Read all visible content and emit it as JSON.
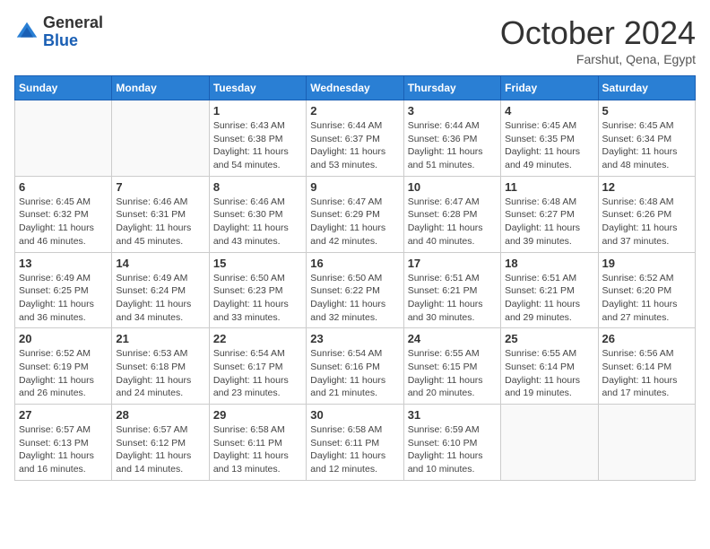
{
  "header": {
    "logo_line1": "General",
    "logo_line2": "Blue",
    "month": "October 2024",
    "location": "Farshut, Qena, Egypt"
  },
  "days_of_week": [
    "Sunday",
    "Monday",
    "Tuesday",
    "Wednesday",
    "Thursday",
    "Friday",
    "Saturday"
  ],
  "weeks": [
    [
      {
        "day": "",
        "info": ""
      },
      {
        "day": "",
        "info": ""
      },
      {
        "day": "1",
        "info": "Sunrise: 6:43 AM\nSunset: 6:38 PM\nDaylight: 11 hours and 54 minutes."
      },
      {
        "day": "2",
        "info": "Sunrise: 6:44 AM\nSunset: 6:37 PM\nDaylight: 11 hours and 53 minutes."
      },
      {
        "day": "3",
        "info": "Sunrise: 6:44 AM\nSunset: 6:36 PM\nDaylight: 11 hours and 51 minutes."
      },
      {
        "day": "4",
        "info": "Sunrise: 6:45 AM\nSunset: 6:35 PM\nDaylight: 11 hours and 49 minutes."
      },
      {
        "day": "5",
        "info": "Sunrise: 6:45 AM\nSunset: 6:34 PM\nDaylight: 11 hours and 48 minutes."
      }
    ],
    [
      {
        "day": "6",
        "info": "Sunrise: 6:45 AM\nSunset: 6:32 PM\nDaylight: 11 hours and 46 minutes."
      },
      {
        "day": "7",
        "info": "Sunrise: 6:46 AM\nSunset: 6:31 PM\nDaylight: 11 hours and 45 minutes."
      },
      {
        "day": "8",
        "info": "Sunrise: 6:46 AM\nSunset: 6:30 PM\nDaylight: 11 hours and 43 minutes."
      },
      {
        "day": "9",
        "info": "Sunrise: 6:47 AM\nSunset: 6:29 PM\nDaylight: 11 hours and 42 minutes."
      },
      {
        "day": "10",
        "info": "Sunrise: 6:47 AM\nSunset: 6:28 PM\nDaylight: 11 hours and 40 minutes."
      },
      {
        "day": "11",
        "info": "Sunrise: 6:48 AM\nSunset: 6:27 PM\nDaylight: 11 hours and 39 minutes."
      },
      {
        "day": "12",
        "info": "Sunrise: 6:48 AM\nSunset: 6:26 PM\nDaylight: 11 hours and 37 minutes."
      }
    ],
    [
      {
        "day": "13",
        "info": "Sunrise: 6:49 AM\nSunset: 6:25 PM\nDaylight: 11 hours and 36 minutes."
      },
      {
        "day": "14",
        "info": "Sunrise: 6:49 AM\nSunset: 6:24 PM\nDaylight: 11 hours and 34 minutes."
      },
      {
        "day": "15",
        "info": "Sunrise: 6:50 AM\nSunset: 6:23 PM\nDaylight: 11 hours and 33 minutes."
      },
      {
        "day": "16",
        "info": "Sunrise: 6:50 AM\nSunset: 6:22 PM\nDaylight: 11 hours and 32 minutes."
      },
      {
        "day": "17",
        "info": "Sunrise: 6:51 AM\nSunset: 6:21 PM\nDaylight: 11 hours and 30 minutes."
      },
      {
        "day": "18",
        "info": "Sunrise: 6:51 AM\nSunset: 6:21 PM\nDaylight: 11 hours and 29 minutes."
      },
      {
        "day": "19",
        "info": "Sunrise: 6:52 AM\nSunset: 6:20 PM\nDaylight: 11 hours and 27 minutes."
      }
    ],
    [
      {
        "day": "20",
        "info": "Sunrise: 6:52 AM\nSunset: 6:19 PM\nDaylight: 11 hours and 26 minutes."
      },
      {
        "day": "21",
        "info": "Sunrise: 6:53 AM\nSunset: 6:18 PM\nDaylight: 11 hours and 24 minutes."
      },
      {
        "day": "22",
        "info": "Sunrise: 6:54 AM\nSunset: 6:17 PM\nDaylight: 11 hours and 23 minutes."
      },
      {
        "day": "23",
        "info": "Sunrise: 6:54 AM\nSunset: 6:16 PM\nDaylight: 11 hours and 21 minutes."
      },
      {
        "day": "24",
        "info": "Sunrise: 6:55 AM\nSunset: 6:15 PM\nDaylight: 11 hours and 20 minutes."
      },
      {
        "day": "25",
        "info": "Sunrise: 6:55 AM\nSunset: 6:14 PM\nDaylight: 11 hours and 19 minutes."
      },
      {
        "day": "26",
        "info": "Sunrise: 6:56 AM\nSunset: 6:14 PM\nDaylight: 11 hours and 17 minutes."
      }
    ],
    [
      {
        "day": "27",
        "info": "Sunrise: 6:57 AM\nSunset: 6:13 PM\nDaylight: 11 hours and 16 minutes."
      },
      {
        "day": "28",
        "info": "Sunrise: 6:57 AM\nSunset: 6:12 PM\nDaylight: 11 hours and 14 minutes."
      },
      {
        "day": "29",
        "info": "Sunrise: 6:58 AM\nSunset: 6:11 PM\nDaylight: 11 hours and 13 minutes."
      },
      {
        "day": "30",
        "info": "Sunrise: 6:58 AM\nSunset: 6:11 PM\nDaylight: 11 hours and 12 minutes."
      },
      {
        "day": "31",
        "info": "Sunrise: 6:59 AM\nSunset: 6:10 PM\nDaylight: 11 hours and 10 minutes."
      },
      {
        "day": "",
        "info": ""
      },
      {
        "day": "",
        "info": ""
      }
    ]
  ]
}
